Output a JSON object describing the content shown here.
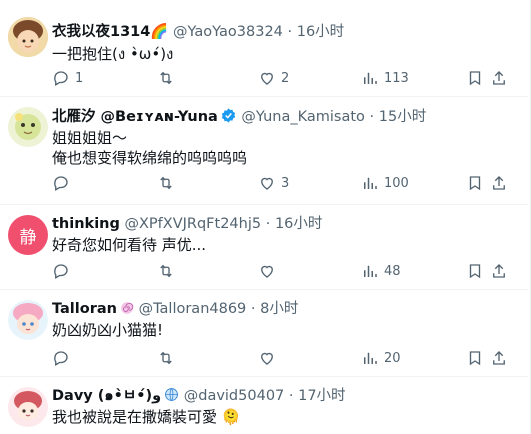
{
  "tweets": [
    {
      "name": "衣我以夜1314🌈",
      "handle": "@YaoYao38324",
      "time": "16小时",
      "text": "一把抱住(ง •̀ω•́)ง",
      "avatar_color": "#d9a46b",
      "counts": {
        "reply": "1",
        "retweet": "",
        "like": "2",
        "views": "113"
      }
    },
    {
      "name": "北雁汐 @Beɪʏᴀɴ-Yuna",
      "handle": "@Yuna_Kamisato",
      "time": "15小时",
      "text": "姐姐姐姐～\n俺也想变得软绵绵的呜呜呜呜",
      "avatar_color": "#c9d98a",
      "verified_color": "#1d9bf0",
      "counts": {
        "reply": "",
        "retweet": "",
        "like": "3",
        "views": "100"
      }
    },
    {
      "name": "thinking",
      "handle": "@XPfXVJRqFt24hj5",
      "time": "16小时",
      "text": "好奇您如何看待 声优...",
      "avatar_letter": "静",
      "avatar_color": "#f0506e",
      "counts": {
        "reply": "",
        "retweet": "",
        "like": "",
        "views": "48"
      }
    },
    {
      "name": "Talloran",
      "handle": "@Talloran4869",
      "time": "8小时",
      "text": "奶凶奶凶小猫猫!",
      "avatar_color": "#f5b7c8",
      "counts": {
        "reply": "",
        "retweet": "",
        "like": "",
        "views": "20"
      }
    },
    {
      "name": "Davy (๑•̀ㅂ•́)و",
      "handle": "@david50407",
      "time": "17小时",
      "text": "我也被說是在撒嬌裝可愛 🫠",
      "avatar_color": "#f4c0c8",
      "counts": {
        "reply": "",
        "retweet": "",
        "like": "",
        "views": ""
      }
    }
  ],
  "separator": "·",
  "colors": {
    "text": "#0f1419",
    "muted": "#536471",
    "border": "#eff3f4",
    "verified": "#1d9bf0"
  }
}
